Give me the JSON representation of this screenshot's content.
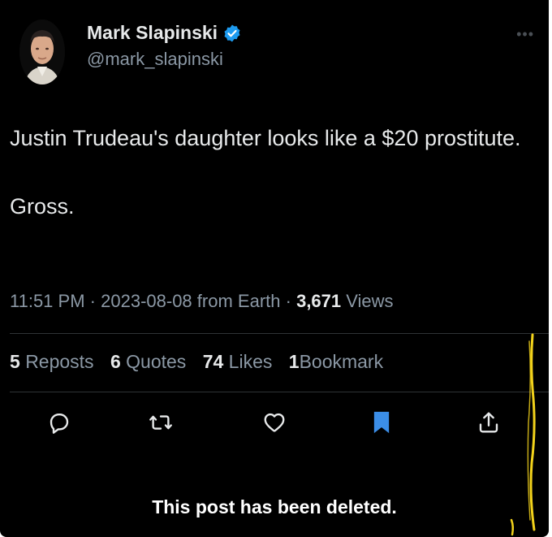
{
  "author": {
    "display_name": "Mark Slapinski",
    "handle": "@mark_slapinski",
    "verified": true
  },
  "post": {
    "line1": "Justin Trudeau's daughter looks like a $20 prostitute.",
    "line2": "Gross."
  },
  "meta": {
    "time": "11:51 PM",
    "date": "2023-08-08",
    "source": "from Earth",
    "views_count": "3,671",
    "views_label": "Views"
  },
  "stats": {
    "reposts_count": "5",
    "reposts_label": "Reposts",
    "quotes_count": "6",
    "quotes_label": "Quotes",
    "likes_count": "74",
    "likes_label": "Likes",
    "bookmarks_count": "1",
    "bookmarks_label": "Bookmark"
  },
  "actions": [
    {
      "icon": "reply-icon"
    },
    {
      "icon": "repost-icon"
    },
    {
      "icon": "like-icon"
    },
    {
      "icon": "bookmark-icon",
      "active": true
    },
    {
      "icon": "share-icon"
    }
  ],
  "notice": "This post has been deleted.",
  "colors": {
    "background": "#000000",
    "text": "#e7e9ea",
    "secondary": "#8b98a5",
    "accent": "#1d9bf0",
    "bookmark_active": "#3b8ee8"
  }
}
